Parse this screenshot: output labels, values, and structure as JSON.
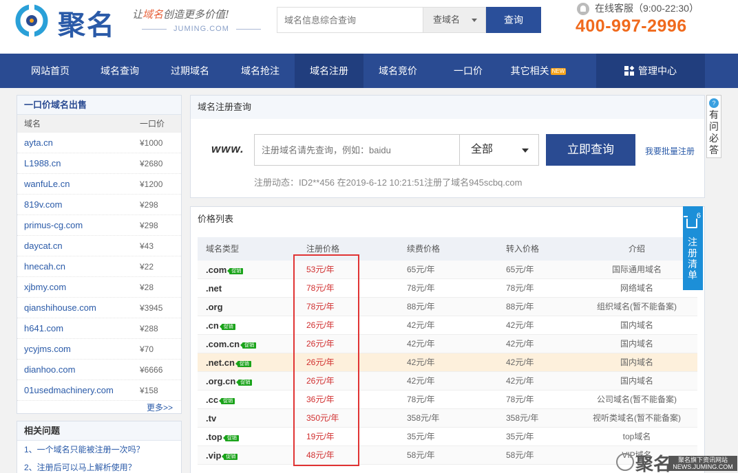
{
  "header": {
    "brand": "聚名",
    "slogan_pre": "让",
    "slogan_hl": "域名",
    "slogan_post": "创造更多价值!",
    "site": "JUMING.COM",
    "search_placeholder": "域名信息综合查询",
    "search_select": "查域名",
    "search_button": "查询",
    "service": "在线客服（9:00-22:30）",
    "hotline": "400-997-2996"
  },
  "nav": {
    "items": [
      "网站首页",
      "域名查询",
      "过期域名",
      "域名抢注",
      "域名注册",
      "域名竞价",
      "一口价",
      "其它相关"
    ],
    "new_badge": "NEW",
    "manage": "管理中心"
  },
  "sale_panel": {
    "title": "一口价域名出售",
    "col_domain": "域名",
    "col_price": "一口价",
    "rows": [
      {
        "domain": "ayta.cn",
        "price": "¥1000"
      },
      {
        "domain": "L1988.cn",
        "price": "¥2680"
      },
      {
        "domain": "wanfuLe.cn",
        "price": "¥1200"
      },
      {
        "domain": "819v.com",
        "price": "¥298"
      },
      {
        "domain": "primus-cg.com",
        "price": "¥298"
      },
      {
        "domain": "daycat.cn",
        "price": "¥43"
      },
      {
        "domain": "hnecah.cn",
        "price": "¥22"
      },
      {
        "domain": "xjbmy.com",
        "price": "¥28"
      },
      {
        "domain": "qianshihouse.com",
        "price": "¥3945"
      },
      {
        "domain": "h641.com",
        "price": "¥288"
      },
      {
        "domain": "ycyjms.com",
        "price": "¥70"
      },
      {
        "domain": "dianhoo.com",
        "price": "¥6666"
      },
      {
        "domain": "01usedmachinery.com",
        "price": "¥158"
      }
    ],
    "more": "更多>>"
  },
  "questions": {
    "title": "相关问题",
    "items": [
      "1、一个域名只能被注册一次吗？",
      "2、注册后可以马上解析使用？"
    ]
  },
  "register": {
    "title": "域名注册查询",
    "www": "www.",
    "placeholder": "注册域名请先查询，例如：baidu",
    "select": "全部",
    "button": "立即查询",
    "batch": "我要批量注册",
    "dynamic": "注册动态：ID2**456 在2019-6-12 10:21:51注册了域名945scbq.com"
  },
  "price": {
    "title": "价格列表",
    "headers": [
      "域名类型",
      "注册价格",
      "续费价格",
      "转入价格",
      "介绍"
    ],
    "promo_label": "促销",
    "rows": [
      {
        "type": ".com",
        "promo": true,
        "reg": "53元/年",
        "renew": "65元/年",
        "transfer": "65元/年",
        "intro": "国际通用域名"
      },
      {
        "type": ".net",
        "promo": false,
        "reg": "78元/年",
        "renew": "78元/年",
        "transfer": "78元/年",
        "intro": "网络域名"
      },
      {
        "type": ".org",
        "promo": false,
        "reg": "78元/年",
        "renew": "88元/年",
        "transfer": "88元/年",
        "intro": "组织域名(暂不能备案)"
      },
      {
        "type": ".cn",
        "promo": true,
        "reg": "26元/年",
        "renew": "42元/年",
        "transfer": "42元/年",
        "intro": "国内域名"
      },
      {
        "type": ".com.cn",
        "promo": true,
        "reg": "26元/年",
        "renew": "42元/年",
        "transfer": "42元/年",
        "intro": "国内域名"
      },
      {
        "type": ".net.cn",
        "promo": true,
        "reg": "26元/年",
        "renew": "42元/年",
        "transfer": "42元/年",
        "intro": "国内域名"
      },
      {
        "type": ".org.cn",
        "promo": true,
        "reg": "26元/年",
        "renew": "42元/年",
        "transfer": "42元/年",
        "intro": "国内域名"
      },
      {
        "type": ".cc",
        "promo": true,
        "reg": "36元/年",
        "renew": "78元/年",
        "transfer": "78元/年",
        "intro": "公司域名(暂不能备案)"
      },
      {
        "type": ".tv",
        "promo": false,
        "reg": "350元/年",
        "renew": "358元/年",
        "transfer": "358元/年",
        "intro": "视听类域名(暂不能备案)"
      },
      {
        "type": ".top",
        "promo": true,
        "reg": "19元/年",
        "renew": "35元/年",
        "transfer": "35元/年",
        "intro": "top域名"
      },
      {
        "type": ".vip",
        "promo": true,
        "reg": "48元/年",
        "renew": "58元/年",
        "transfer": "58元/年",
        "intro": "VIP域名"
      }
    ]
  },
  "cart": {
    "count": "6",
    "label": "注册清单"
  },
  "faq": {
    "q": "?",
    "label": "有问必答"
  },
  "watermark": {
    "brand": "聚名",
    "line1": "聚名旗下资讯网站",
    "line2": "NEWS.JUMING.COM"
  },
  "colors": {
    "primary": "#2a4b92",
    "accent": "#f06a1d",
    "promo": "#1aa31a",
    "price_red": "#d02d2d",
    "highlight_row": "#fdf0dc",
    "cart_blue": "#1c8fd8"
  }
}
